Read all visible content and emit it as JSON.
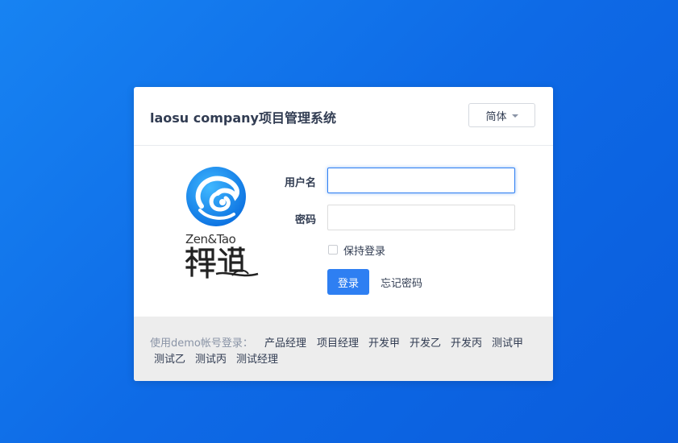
{
  "header": {
    "title": "laosu company项目管理系统",
    "language": "简体"
  },
  "logo": {
    "brand_text": "Zen&Tao",
    "icon": "zentao-logo-icon"
  },
  "form": {
    "username_label": "用户名",
    "username_value": "",
    "password_label": "密码",
    "password_value": "",
    "remember_label": "保持登录",
    "remember_checked": false,
    "login_button": "登录",
    "forgot_link": "忘记密码"
  },
  "demo": {
    "label": "使用demo帐号登录：",
    "accounts": [
      "产品经理",
      "项目经理",
      "开发甲",
      "开发乙",
      "开发丙",
      "测试甲",
      "测试乙",
      "测试丙",
      "测试经理"
    ]
  },
  "colors": {
    "background": "#1473ea",
    "primary": "#2e7ff2",
    "footer_bg": "#ededed"
  }
}
